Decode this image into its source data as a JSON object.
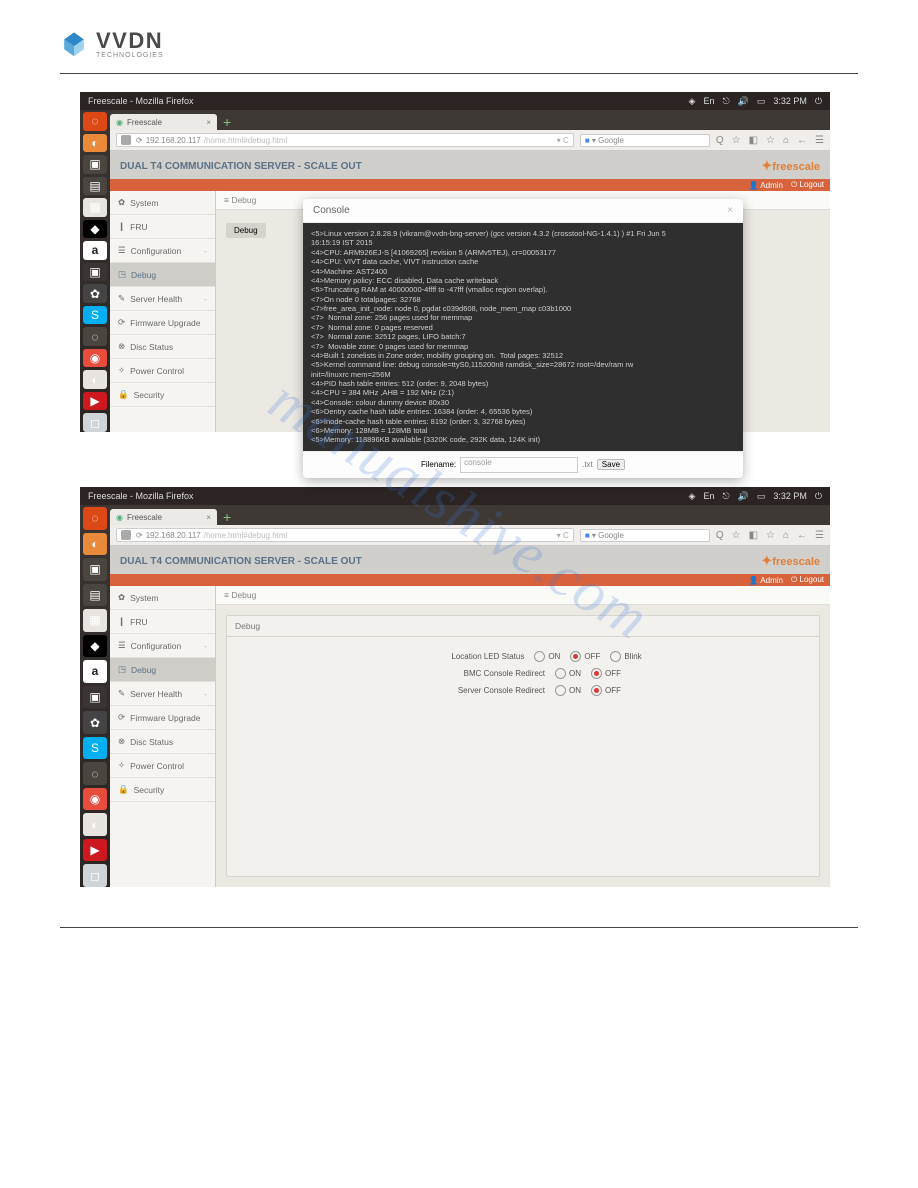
{
  "logo": {
    "name": "VVDN",
    "sub": "TECHNOLOGIES"
  },
  "watermark": "manualshive.com",
  "topbar": {
    "title": "Freescale - Mozilla Firefox",
    "time": "3:32 PM"
  },
  "tab": {
    "title": "Freescale"
  },
  "url": {
    "host": "192.168.20.117",
    "path": "/home.html#debug.html"
  },
  "search": {
    "placeholder": "Google"
  },
  "navicons": [
    "Q",
    "☆",
    "◧",
    "☆",
    "⌂",
    "←"
  ],
  "app": {
    "title": "DUAL T4 COMMUNICATION SERVER - SCALE OUT",
    "brand": "freescale",
    "userbar": {
      "admin": "Admin",
      "logout": "Logout"
    },
    "sidebar": [
      {
        "icon": "✿",
        "label": "System"
      },
      {
        "icon": "❙",
        "label": "FRU"
      },
      {
        "icon": "☰",
        "label": "Configuration",
        "expand": "-"
      },
      {
        "icon": "◳",
        "label": "Debug",
        "active": true
      },
      {
        "icon": "✎",
        "label": "Server Health",
        "expand": "-"
      },
      {
        "icon": "⟳",
        "label": "Firmware Upgrade"
      },
      {
        "icon": "⊗",
        "label": "Disc Status"
      },
      {
        "icon": "✧",
        "label": "Power Control"
      },
      {
        "icon": "🔒",
        "label": "Security"
      }
    ],
    "crumb": "≡  Debug",
    "panel": {
      "title": "Debug"
    }
  },
  "modal": {
    "title": "Console",
    "lines": [
      "<5>Linux version 2.8.28.9 (vikram@vvdn-bng-server) (gcc version 4.3.2 (crosstool-NG-1.4.1) ) #1 Fri Jun 5",
      "16:15:19 IST 2015",
      "<4>CPU: ARM926EJ-S [41069265] revision 5 (ARMv5TEJ), cr=00053177",
      "<4>CPU: VIVT data cache, VIVT instruction cache",
      "<4>Machine: AST2400",
      "<4>Memory policy: ECC disabled, Data cache writeback",
      "<5>Truncating RAM at 40000000-4ffff to -47fff (vmalloc region overlap).",
      "<7>On node 0 totalpages: 32768",
      "<7>free_area_init_node: node 0, pgdat c039d608, node_mem_map c03b1000",
      "<7>  Normal zone: 256 pages used for memmap",
      "<7>  Normal zone: 0 pages reserved",
      "<7>  Normal zone: 32512 pages, LIFO batch:7",
      "<7>  Movable zone: 0 pages used for memmap",
      "<4>Built 1 zonelists in Zone order, mobility grouping on.  Total pages: 32512",
      "<5>Kernel command line: debug console=ttyS0,115200n8 ramdisk_size=28672 root=/dev/ram rw",
      "init=/linuxrc mem=256M",
      "<4>PID hash table entries: 512 (order: 9, 2048 bytes)",
      "<4>CPU = 384 MHz ,AHB = 192 MHz (2:1)",
      "<4>Console: colour dummy device 80x30",
      "<6>Dentry cache hash table entries: 16384 (order: 4, 65536 bytes)",
      "<6>Inode-cache hash table entries: 8192 (order: 3, 32768 bytes)",
      "<6>Memory: 128MB = 128MB total",
      "<5>Memory: 118896KB available (3320K code, 292K data, 124K init)"
    ],
    "filename_label": "Filename:",
    "filename_value": "console",
    "ext": ".txt",
    "save": "Save"
  },
  "debug": {
    "rows": [
      {
        "label": "Location LED Status",
        "options": [
          "ON",
          "OFF",
          "Blink"
        ],
        "selected": 1
      },
      {
        "label": "BMC Console Redirect",
        "options": [
          "ON",
          "OFF"
        ],
        "selected": 1
      },
      {
        "label": "Server Console Redirect",
        "options": [
          "ON",
          "OFF"
        ],
        "selected": 1
      }
    ]
  }
}
